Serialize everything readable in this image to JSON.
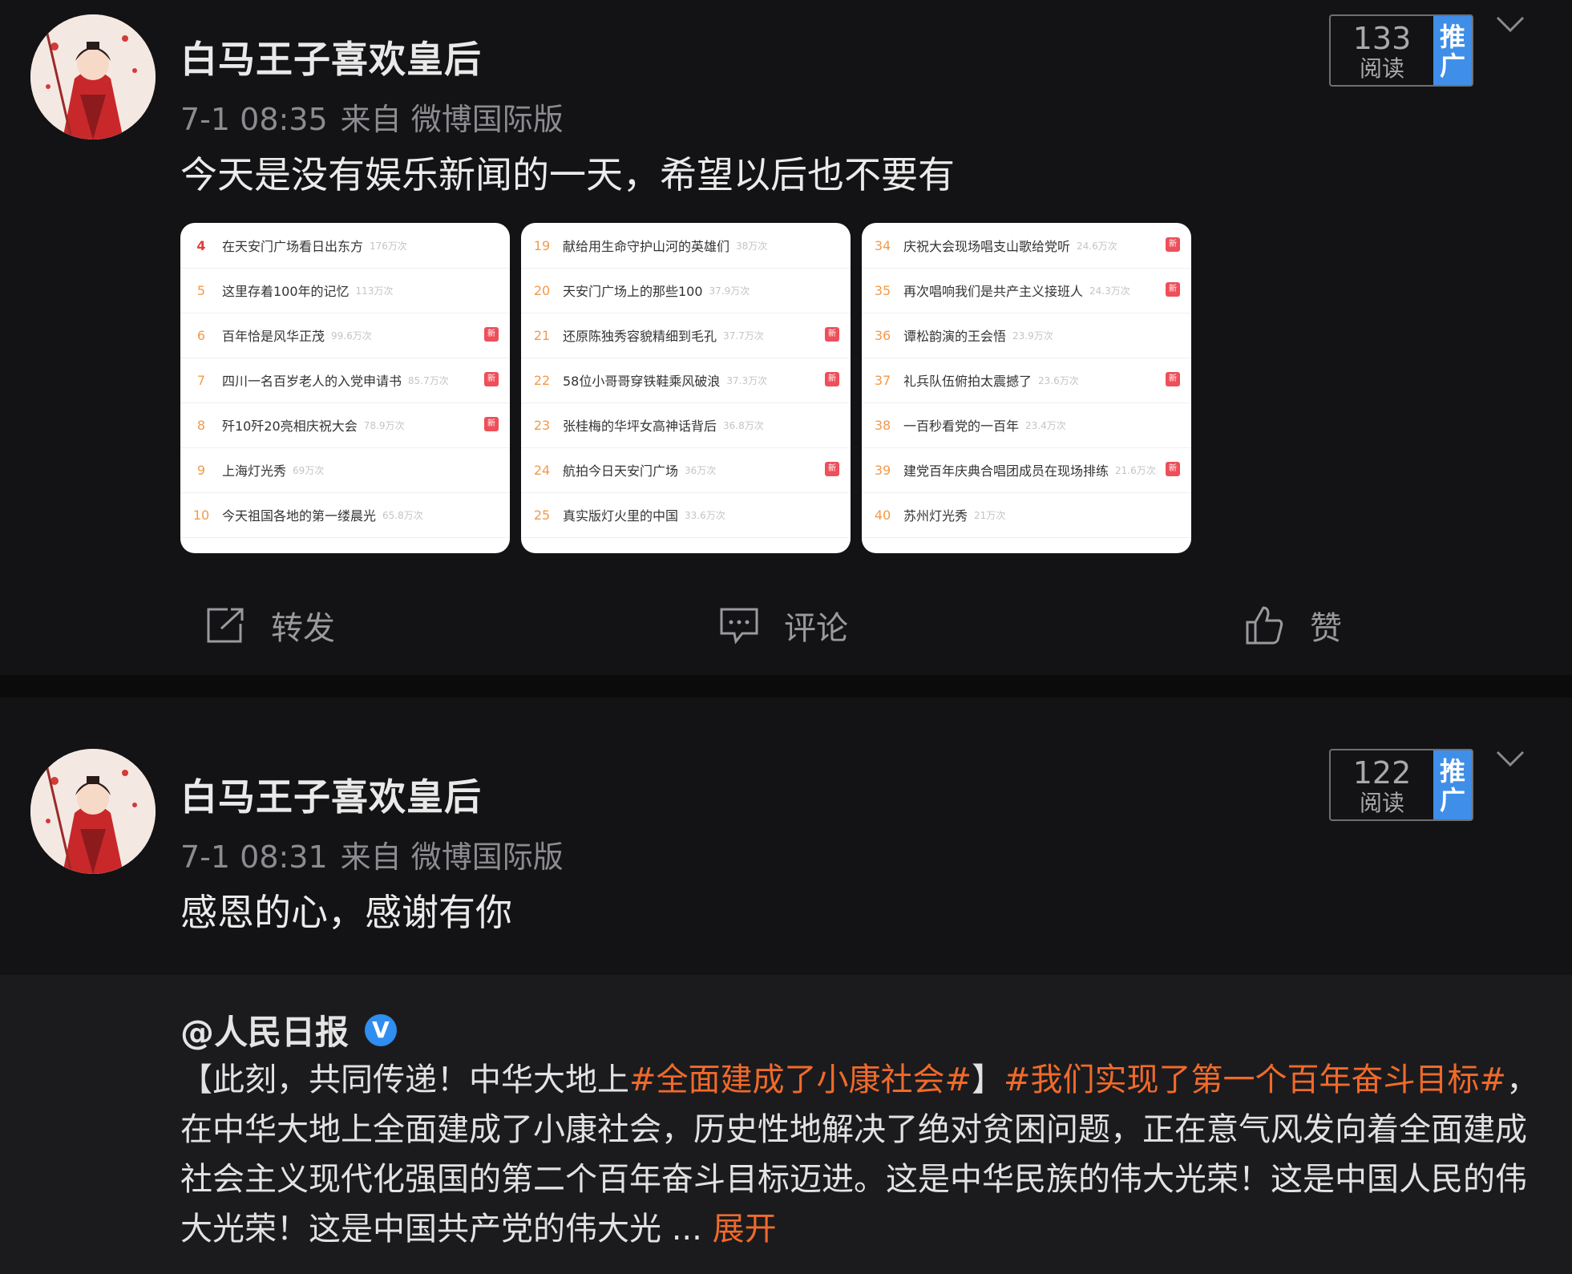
{
  "posts": [
    {
      "username": "白马王子喜欢皇后",
      "time": "7-1 08:35",
      "source": "来自 微博国际版",
      "text": "今天是没有娱乐新闻的一天，希望以后也不要有",
      "reads": {
        "count": "133",
        "label": "阅读",
        "promo": "推广"
      }
    },
    {
      "username": "白马王子喜欢皇后",
      "time": "7-1 08:31",
      "source": "来自 微博国际版",
      "text": "感恩的心，感谢有你",
      "reads": {
        "count": "122",
        "label": "阅读",
        "promo": "推广"
      }
    }
  ],
  "image_cards": [
    {
      "rows": [
        {
          "rank": "4",
          "title": "在天安门广场看日出东方",
          "heat": "176万次",
          "tag": ""
        },
        {
          "rank": "5",
          "title": "这里存着100年的记忆",
          "heat": "113万次",
          "tag": ""
        },
        {
          "rank": "6",
          "title": "百年恰是风华正茂",
          "heat": "99.6万次",
          "tag": "新"
        },
        {
          "rank": "7",
          "title": "四川一名百岁老人的入党申请书",
          "heat": "85.7万次",
          "tag": "新"
        },
        {
          "rank": "8",
          "title": "歼10歼20亮相庆祝大会",
          "heat": "78.9万次",
          "tag": "新"
        },
        {
          "rank": "9",
          "title": "上海灯光秀",
          "heat": "69万次",
          "tag": ""
        },
        {
          "rank": "10",
          "title": "今天祖国各地的第一缕晨光",
          "heat": "65.8万次",
          "tag": ""
        }
      ]
    },
    {
      "rows": [
        {
          "rank": "19",
          "title": "献给用生命守护山河的英雄们",
          "heat": "38万次",
          "tag": ""
        },
        {
          "rank": "20",
          "title": "天安门广场上的那些100",
          "heat": "37.9万次",
          "tag": ""
        },
        {
          "rank": "21",
          "title": "还原陈独秀容貌精细到毛孔",
          "heat": "37.7万次",
          "tag": "新"
        },
        {
          "rank": "22",
          "title": "58位小哥哥穿铁鞋乘风破浪",
          "heat": "37.3万次",
          "tag": "新"
        },
        {
          "rank": "23",
          "title": "张桂梅的华坪女高神话背后",
          "heat": "36.8万次",
          "tag": ""
        },
        {
          "rank": "24",
          "title": "航拍今日天安门广场",
          "heat": "36万次",
          "tag": "新"
        },
        {
          "rank": "25",
          "title": "真实版灯火里的中国",
          "heat": "33.6万次",
          "tag": ""
        }
      ]
    },
    {
      "rows": [
        {
          "rank": "34",
          "title": "庆祝大会现场唱支山歌给党听",
          "heat": "24.6万次",
          "tag": "新"
        },
        {
          "rank": "35",
          "title": "再次唱响我们是共产主义接班人",
          "heat": "24.3万次",
          "tag": "新"
        },
        {
          "rank": "36",
          "title": "谭松韵演的王会悟",
          "heat": "23.9万次",
          "tag": ""
        },
        {
          "rank": "37",
          "title": "礼兵队伍俯拍太震撼了",
          "heat": "23.6万次",
          "tag": "新"
        },
        {
          "rank": "38",
          "title": "一百秒看党的一百年",
          "heat": "23.4万次",
          "tag": ""
        },
        {
          "rank": "39",
          "title": "建党百年庆典合唱团成员在现场排练",
          "heat": "21.6万次",
          "tag": "新"
        },
        {
          "rank": "40",
          "title": "苏州灯光秀",
          "heat": "21万次",
          "tag": ""
        }
      ]
    }
  ],
  "actions": {
    "repost": "转发",
    "comment": "评论",
    "like": "赞"
  },
  "repost": {
    "user": "@人民日报",
    "verified_mark": "V",
    "text_parts": [
      {
        "text": "【此刻，共同传递！中华大地上",
        "hashtag": false
      },
      {
        "text": "#全面建成了小康社会#",
        "hashtag": true
      },
      {
        "text": "】",
        "hashtag": false
      },
      {
        "text": "#我们实现了第一个百年奋斗目标#",
        "hashtag": true
      },
      {
        "text": "，在中华大地上全面建成了小康社会，历史性地解决了绝对贫困问题，正在意气风发向着全面建成社会主义现代化强国的第二个百年奋斗目标迈进。这是中华民族的伟大光荣！这是中国人民的伟大光荣！这是中国共产党的伟大光 ",
        "hashtag": false
      }
    ],
    "ellipsis": "...",
    "expand_label": "展开"
  },
  "colors": {
    "hashtag": "#f06a2a",
    "promo": "#3f8ee8",
    "verified": "#2f8ef0",
    "rank_top": "#e63c3c",
    "rank": "#f29a4a",
    "tag_new": "#ee4f5a"
  }
}
